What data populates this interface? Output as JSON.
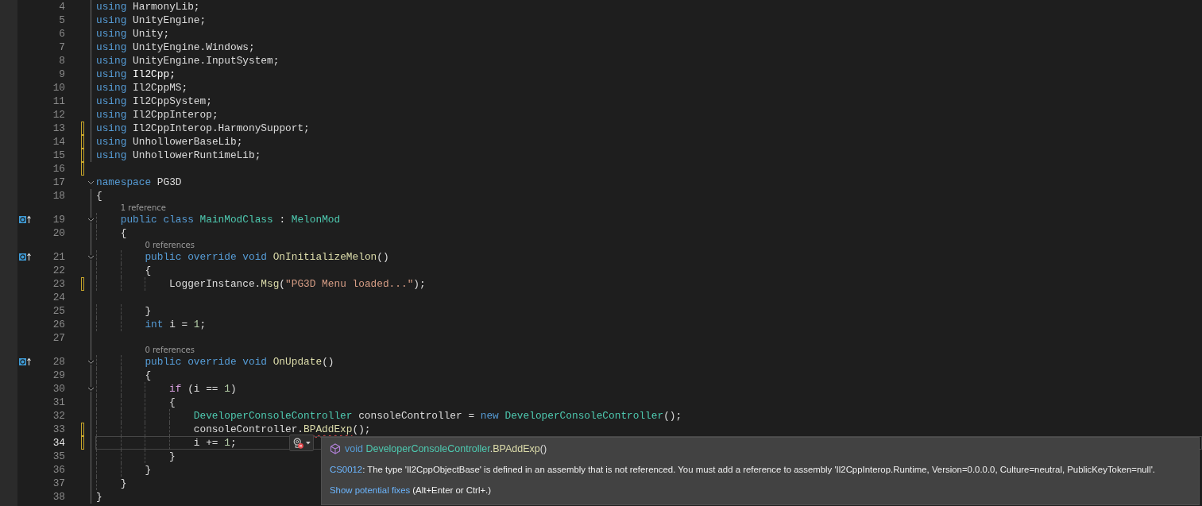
{
  "lines": [
    {
      "number": "4",
      "changed": false,
      "region": true,
      "foldable": false,
      "override": false,
      "current": false,
      "tokens": [
        {
          "kind": "keyword",
          "text": "using "
        },
        {
          "kind": "plain",
          "text": "HarmonyLib;"
        }
      ]
    },
    {
      "number": "5",
      "changed": false,
      "region": true,
      "foldable": false,
      "override": false,
      "current": false,
      "tokens": [
        {
          "kind": "keyword",
          "text": "using "
        },
        {
          "kind": "plain",
          "text": "UnityEngine;"
        }
      ]
    },
    {
      "number": "6",
      "changed": false,
      "region": true,
      "foldable": false,
      "override": false,
      "current": false,
      "tokens": [
        {
          "kind": "keyword",
          "text": "using "
        },
        {
          "kind": "plain",
          "text": "Unity;"
        }
      ]
    },
    {
      "number": "7",
      "changed": false,
      "region": true,
      "foldable": false,
      "override": false,
      "current": false,
      "tokens": [
        {
          "kind": "keyword",
          "text": "using "
        },
        {
          "kind": "plain",
          "text": "UnityEngine.Windows;"
        }
      ]
    },
    {
      "number": "8",
      "changed": false,
      "region": true,
      "foldable": false,
      "override": false,
      "current": false,
      "tokens": [
        {
          "kind": "keyword",
          "text": "using "
        },
        {
          "kind": "plain",
          "text": "UnityEngine.InputSystem;"
        }
      ]
    },
    {
      "number": "9",
      "changed": false,
      "region": true,
      "foldable": false,
      "override": false,
      "current": false,
      "tokens": [
        {
          "kind": "keyword",
          "text": "using "
        },
        {
          "kind": "bright",
          "text": "Il2Cpp;"
        }
      ]
    },
    {
      "number": "10",
      "changed": false,
      "region": true,
      "foldable": false,
      "override": false,
      "current": false,
      "tokens": [
        {
          "kind": "keyword",
          "text": "using "
        },
        {
          "kind": "plain",
          "text": "Il2CppMS;"
        }
      ]
    },
    {
      "number": "11",
      "changed": false,
      "region": true,
      "foldable": false,
      "override": false,
      "current": false,
      "tokens": [
        {
          "kind": "keyword",
          "text": "using "
        },
        {
          "kind": "plain",
          "text": "Il2CppSystem;"
        }
      ]
    },
    {
      "number": "12",
      "changed": false,
      "region": true,
      "foldable": false,
      "override": false,
      "current": false,
      "tokens": [
        {
          "kind": "keyword",
          "text": "using "
        },
        {
          "kind": "plain",
          "text": "Il2CppInterop;"
        }
      ]
    },
    {
      "number": "13",
      "changed": true,
      "region": true,
      "foldable": false,
      "override": false,
      "current": false,
      "tokens": [
        {
          "kind": "keyword",
          "text": "using "
        },
        {
          "kind": "plain",
          "text": "Il2CppInterop.HarmonySupport;"
        }
      ]
    },
    {
      "number": "14",
      "changed": true,
      "region": true,
      "foldable": false,
      "override": false,
      "current": false,
      "tokens": [
        {
          "kind": "keyword",
          "text": "using "
        },
        {
          "kind": "plain",
          "text": "UnhollowerBaseLib;"
        }
      ]
    },
    {
      "number": "15",
      "changed": true,
      "region": true,
      "foldable": false,
      "override": false,
      "current": false,
      "tokens": [
        {
          "kind": "keyword",
          "text": "using "
        },
        {
          "kind": "plain",
          "text": "UnhollowerRuntimeLib;"
        }
      ]
    },
    {
      "number": "16",
      "changed": true,
      "region": false,
      "foldable": false,
      "override": false,
      "current": false
    },
    {
      "number": "17",
      "changed": false,
      "region": false,
      "foldable": true,
      "override": false,
      "current": false,
      "tokens": [
        {
          "kind": "keyword",
          "text": "namespace "
        },
        {
          "kind": "plain",
          "text": "PG3D"
        }
      ]
    },
    {
      "number": "18",
      "changed": false,
      "region": true,
      "foldable": false,
      "override": false,
      "current": false,
      "tokens": [
        {
          "kind": "plain",
          "text": "{"
        }
      ]
    },
    {
      "number": "19",
      "changed": false,
      "region": true,
      "foldable": true,
      "override": true,
      "current": false,
      "codelens": "1 reference",
      "tokens": [
        {
          "kind": "keyword",
          "text": "    public class "
        },
        {
          "kind": "type",
          "text": "MainModClass"
        },
        {
          "kind": "plain",
          "text": " : "
        },
        {
          "kind": "type",
          "text": "MelonMod"
        }
      ]
    },
    {
      "number": "20",
      "changed": false,
      "region": true,
      "foldable": false,
      "override": false,
      "current": false,
      "tokens": [
        {
          "kind": "plain",
          "text": "    {"
        }
      ]
    },
    {
      "number": "21",
      "changed": false,
      "region": true,
      "foldable": true,
      "override": true,
      "current": false,
      "codelens": "0 references",
      "tokens": [
        {
          "kind": "keyword",
          "text": "        public override void "
        },
        {
          "kind": "method",
          "text": "OnInitializeMelon"
        },
        {
          "kind": "plain",
          "text": "()"
        }
      ]
    },
    {
      "number": "22",
      "changed": false,
      "region": true,
      "foldable": false,
      "override": false,
      "current": false,
      "tokens": [
        {
          "kind": "plain",
          "text": "        {"
        }
      ]
    },
    {
      "number": "23",
      "changed": true,
      "region": true,
      "foldable": false,
      "override": false,
      "current": false,
      "tokens": [
        {
          "kind": "plain",
          "text": "            LoggerInstance."
        },
        {
          "kind": "method",
          "text": "Msg"
        },
        {
          "kind": "plain",
          "text": "("
        },
        {
          "kind": "string",
          "text": "\"PG3D Menu loaded...\""
        },
        {
          "kind": "plain",
          "text": ");"
        }
      ]
    },
    {
      "number": "24",
      "changed": false,
      "region": true,
      "foldable": false,
      "override": false,
      "current": false
    },
    {
      "number": "25",
      "changed": false,
      "region": true,
      "foldable": false,
      "override": false,
      "current": false,
      "tokens": [
        {
          "kind": "plain",
          "text": "        }"
        }
      ]
    },
    {
      "number": "26",
      "changed": false,
      "region": true,
      "foldable": false,
      "override": false,
      "current": false,
      "tokens": [
        {
          "kind": "keyword",
          "text": "        int "
        },
        {
          "kind": "plain",
          "text": "i = "
        },
        {
          "kind": "number",
          "text": "1"
        },
        {
          "kind": "plain",
          "text": ";"
        }
      ]
    },
    {
      "number": "27",
      "changed": false,
      "region": true,
      "foldable": false,
      "override": false,
      "current": false
    },
    {
      "number": "28",
      "changed": false,
      "region": true,
      "foldable": true,
      "override": true,
      "current": false,
      "codelens": "0 references",
      "tokens": [
        {
          "kind": "keyword",
          "text": "        public override void "
        },
        {
          "kind": "method",
          "text": "OnUpdate"
        },
        {
          "kind": "plain",
          "text": "()"
        }
      ]
    },
    {
      "number": "29",
      "changed": false,
      "region": true,
      "foldable": false,
      "override": false,
      "current": false,
      "tokens": [
        {
          "kind": "plain",
          "text": "        {"
        }
      ]
    },
    {
      "number": "30",
      "changed": false,
      "region": true,
      "foldable": true,
      "override": false,
      "current": false,
      "tokens": [
        {
          "kind": "control",
          "text": "            if "
        },
        {
          "kind": "plain",
          "text": "(i == "
        },
        {
          "kind": "number",
          "text": "1"
        },
        {
          "kind": "plain",
          "text": ")"
        }
      ]
    },
    {
      "number": "31",
      "changed": false,
      "region": true,
      "foldable": false,
      "override": false,
      "current": false,
      "tokens": [
        {
          "kind": "plain",
          "text": "            {"
        }
      ]
    },
    {
      "number": "32",
      "changed": false,
      "region": true,
      "foldable": false,
      "override": false,
      "current": false,
      "tokens": [
        {
          "kind": "type",
          "text": "                DeveloperConsoleController"
        },
        {
          "kind": "plain",
          "text": " consoleController = "
        },
        {
          "kind": "keyword",
          "text": "new "
        },
        {
          "kind": "type",
          "text": "DeveloperConsoleController"
        },
        {
          "kind": "plain",
          "text": "();"
        }
      ]
    },
    {
      "number": "33",
      "changed": true,
      "region": true,
      "foldable": false,
      "override": false,
      "current": false,
      "tokens": [
        {
          "kind": "plain",
          "text": "                consoleController."
        },
        {
          "kind": "error",
          "text": "BPAddExp"
        },
        {
          "kind": "plain",
          "text": "();"
        }
      ]
    },
    {
      "number": "34",
      "changed": true,
      "region": true,
      "foldable": false,
      "override": false,
      "current": true,
      "tokens": [
        {
          "kind": "plain",
          "text": "                i += "
        },
        {
          "kind": "number",
          "text": "1"
        },
        {
          "kind": "plain",
          "text": ";"
        }
      ]
    },
    {
      "number": "35",
      "changed": false,
      "region": true,
      "foldable": false,
      "override": false,
      "current": false,
      "tokens": [
        {
          "kind": "plain",
          "text": "            }"
        }
      ]
    },
    {
      "number": "36",
      "changed": false,
      "region": true,
      "foldable": false,
      "override": false,
      "current": false,
      "tokens": [
        {
          "kind": "plain",
          "text": "        }"
        }
      ]
    },
    {
      "number": "37",
      "changed": false,
      "region": true,
      "foldable": false,
      "override": false,
      "current": false,
      "tokens": [
        {
          "kind": "plain",
          "text": "    }"
        }
      ]
    },
    {
      "number": "38",
      "changed": false,
      "region": true,
      "foldable": false,
      "override": false,
      "current": false,
      "tokens": [
        {
          "kind": "plain",
          "text": "}"
        }
      ]
    }
  ],
  "quick_info": {
    "signature": [
      {
        "kind": "keyword",
        "text": "void "
      },
      {
        "kind": "type",
        "text": "DeveloperConsoleController"
      },
      {
        "kind": "plain",
        "text": "."
      },
      {
        "kind": "method",
        "text": "BPAddExp"
      },
      {
        "kind": "plain",
        "text": "()"
      }
    ],
    "error_code": "CS0012",
    "message": ": The type 'Il2CppObjectBase' is defined in an assembly that is not referenced. You must add a reference to assembly 'Il2CppInterop.Runtime, Version=0.0.0.0, Culture=neutral, PublicKeyToken=null'.",
    "fix_link": "Show potential fixes",
    "fix_shortcut": "(Alt+Enter or Ctrl+.)"
  }
}
